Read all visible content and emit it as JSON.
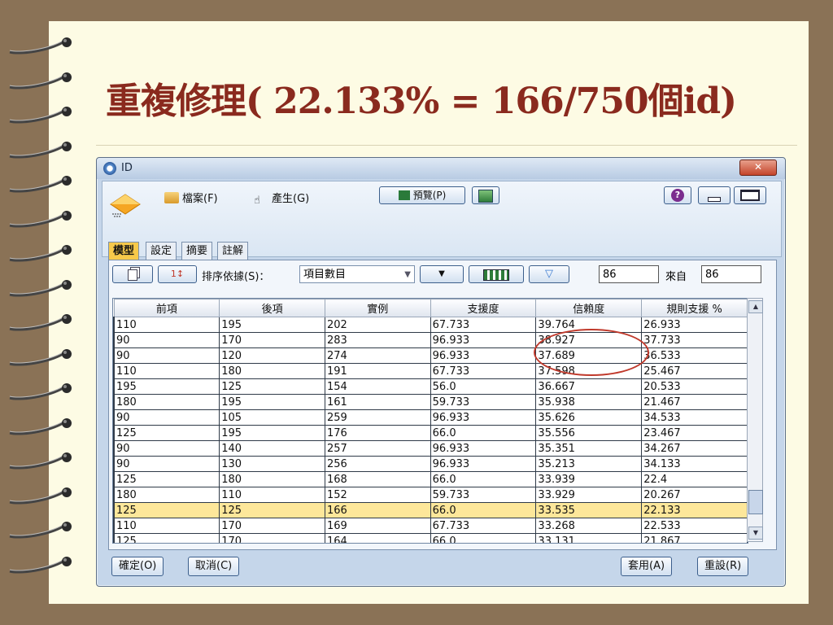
{
  "slide": {
    "title": "重複修理( 22.133% = 166/750個id)"
  },
  "window": {
    "title": "ID",
    "close_label": "✕"
  },
  "menu": {
    "file": "檔案(F)",
    "generate": "產生(G)",
    "preview": "預覽(P)"
  },
  "tabs": [
    "模型",
    "設定",
    "摘要",
    "註解"
  ],
  "toolbar": {
    "sort_label": "排序依據(S)：",
    "sort_value": "項目數目",
    "count_value": "86",
    "from_label": "來自",
    "from_value": "86"
  },
  "table": {
    "headers": [
      "前項",
      "後項",
      "實例",
      "支援度",
      "信賴度",
      "規則支援 %"
    ],
    "rows": [
      [
        "110",
        "195",
        "202",
        "67.733",
        "39.764",
        "26.933"
      ],
      [
        "90",
        "170",
        "283",
        "96.933",
        "38.927",
        "37.733"
      ],
      [
        "90",
        "120",
        "274",
        "96.933",
        "37.689",
        "36.533"
      ],
      [
        "110",
        "180",
        "191",
        "67.733",
        "37.598",
        "25.467"
      ],
      [
        "195",
        "125",
        "154",
        "56.0",
        "36.667",
        "20.533"
      ],
      [
        "180",
        "195",
        "161",
        "59.733",
        "35.938",
        "21.467"
      ],
      [
        "90",
        "105",
        "259",
        "96.933",
        "35.626",
        "34.533"
      ],
      [
        "125",
        "195",
        "176",
        "66.0",
        "35.556",
        "23.467"
      ],
      [
        "90",
        "140",
        "257",
        "96.933",
        "35.351",
        "34.267"
      ],
      [
        "90",
        "130",
        "256",
        "96.933",
        "35.213",
        "34.133"
      ],
      [
        "125",
        "180",
        "168",
        "66.0",
        "33.939",
        "22.4"
      ],
      [
        "180",
        "110",
        "152",
        "59.733",
        "33.929",
        "20.267"
      ],
      [
        "125",
        "125",
        "166",
        "66.0",
        "33.535",
        "22.133"
      ],
      [
        "110",
        "170",
        "169",
        "67.733",
        "33.268",
        "22.533"
      ],
      [
        "125",
        "170",
        "164",
        "66.0",
        "33.131",
        "21.867"
      ]
    ],
    "highlighted_row": 12
  },
  "buttons": {
    "ok": "確定(O)",
    "cancel": "取消(C)",
    "apply": "套用(A)",
    "reset": "重設(R)"
  },
  "colors": {
    "title_red": "#8a2a1e",
    "highlight": "#fde79a",
    "active_tab": "#f7c94a",
    "annotation_circle": "#c0392b"
  }
}
